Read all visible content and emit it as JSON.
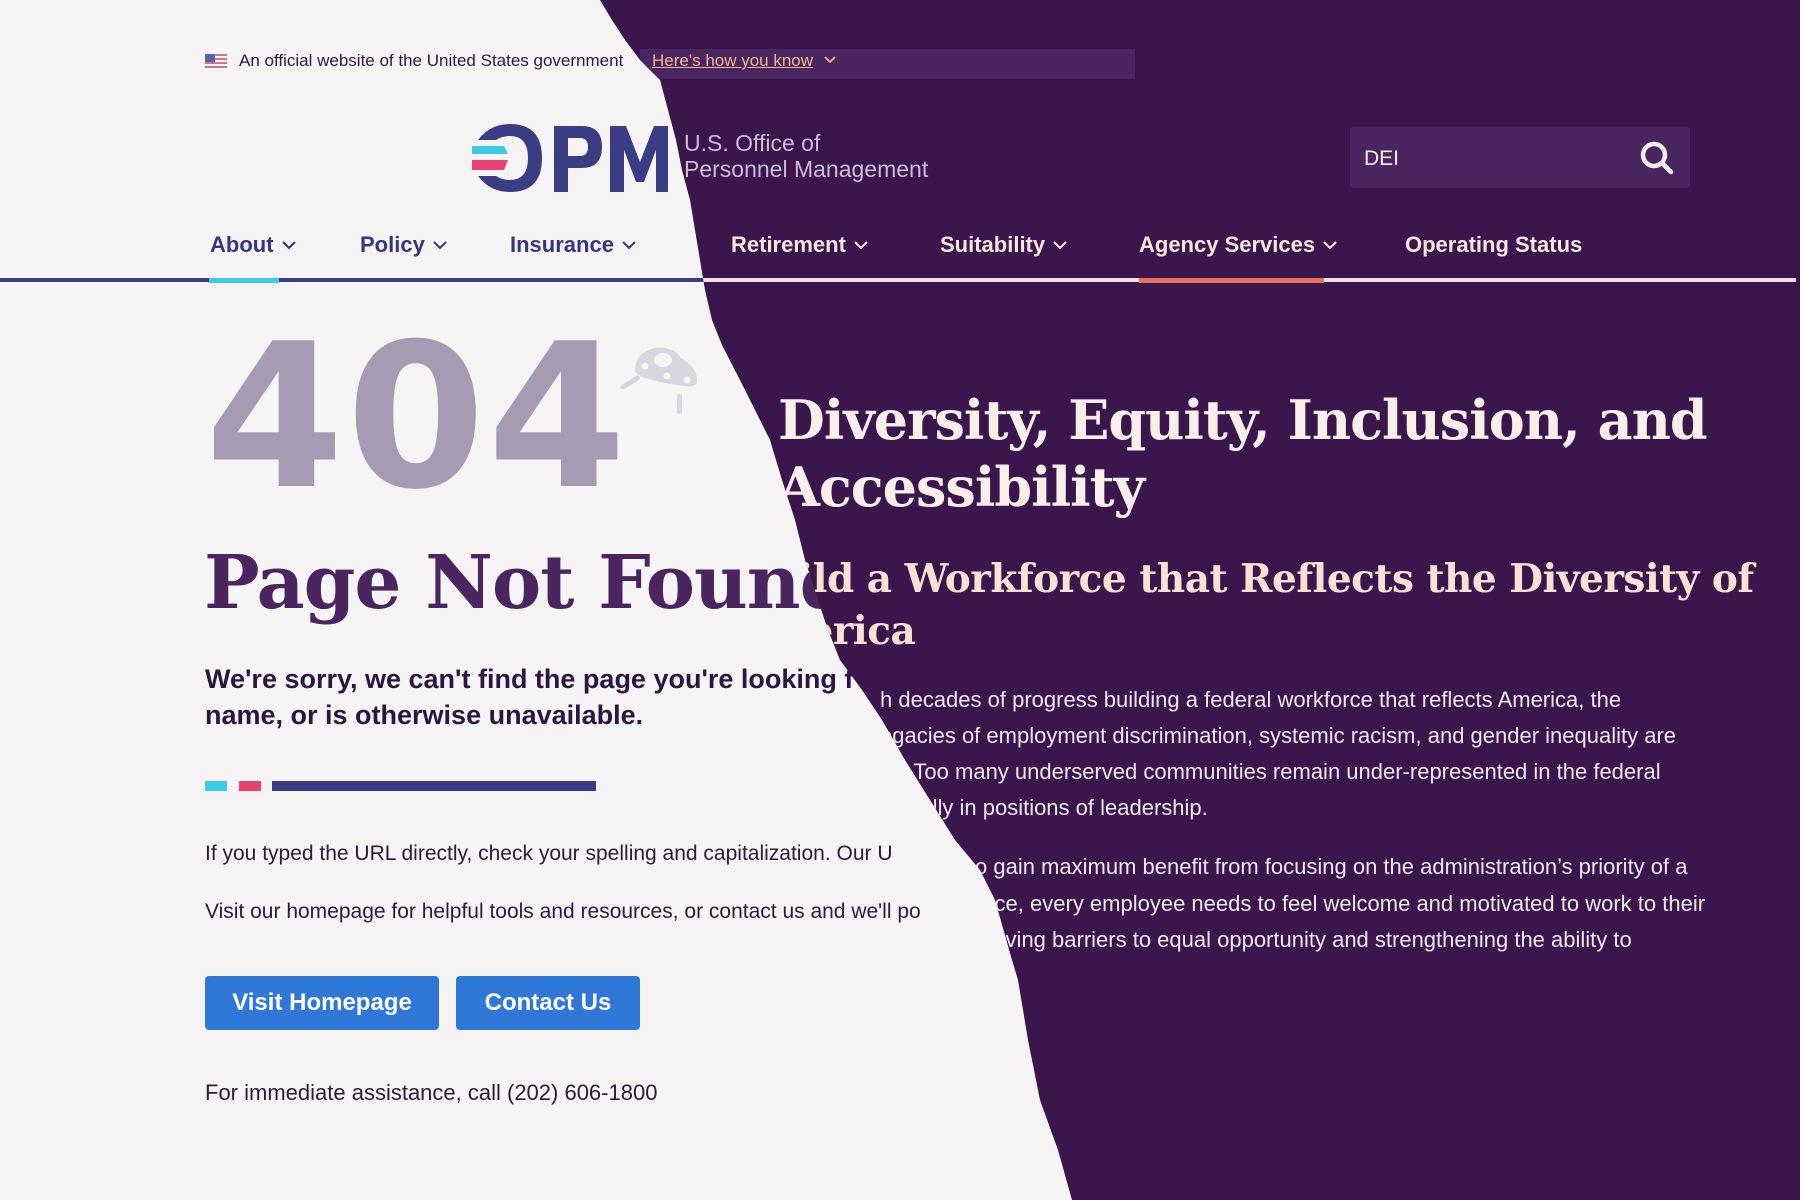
{
  "banner": {
    "official_text": "An official website of the United States government",
    "how_you_know": "Here's how you know",
    "flag_icon": "us-flag-icon"
  },
  "logo": {
    "mark": "OPM",
    "org_line1": "U.S. Office of",
    "org_line2": "Personnel Management"
  },
  "search": {
    "value": "DEI",
    "icon": "search-icon"
  },
  "nav": {
    "items": [
      {
        "label": "About",
        "has_dropdown": true
      },
      {
        "label": "Policy",
        "has_dropdown": true
      },
      {
        "label": "Insurance",
        "has_dropdown": true
      },
      {
        "label": "Retirement",
        "has_dropdown": true
      },
      {
        "label": "Suitability",
        "has_dropdown": true
      },
      {
        "label": "Agency Services",
        "has_dropdown": true
      },
      {
        "label": "Operating Status",
        "has_dropdown": false
      }
    ],
    "active_light": "About",
    "active_dark": "Agency Services"
  },
  "not_found": {
    "code": "404",
    "title": "Page Not Found",
    "sorry_line1": "We're sorry, we can't find the page you're looking f",
    "sorry_line2": "name, or is otherwise unavailable.",
    "para1": "If you typed the URL directly, check your spelling and capitalization. Our U",
    "para2": "Visit our homepage for helpful tools and resources, or contact us and we'll po",
    "buttons": {
      "visit_homepage": "Visit Homepage",
      "contact_us": "Contact Us"
    },
    "phone_text": "For immediate assistance, call (202) 606-1800"
  },
  "dei": {
    "title_line1": "Diversity, Equity, Inclusion, and",
    "title_line2": "Accessibility",
    "subtitle_line1": "Build a Workforce that Reflects the Diversity of",
    "subtitle_line2": "America",
    "body_p1": [
      "h decades of progress building a federal workforce that reflects America, the",
      "egacies of employment discrimination, systemic racism, and gender inequality are",
      "ay. Too many underserved communities remain under-represented in the federal",
      "pecially in positions of leadership."
    ],
    "body_p2": [
      "o gain maximum benefit from focusing on the administration’s priority of a",
      "orce, every employee needs to feel welcome and motivated to work to their",
      "moving barriers to equal opportunity and strengthening the ability to"
    ]
  },
  "colors": {
    "light_bg": "#f6f4f4",
    "dark_bg": "#3a164c",
    "navy": "#34377d",
    "cyan": "#3ccbe8",
    "pink": "#e8436e",
    "button_blue": "#2f78d8",
    "orange_active": "#e8735a"
  }
}
